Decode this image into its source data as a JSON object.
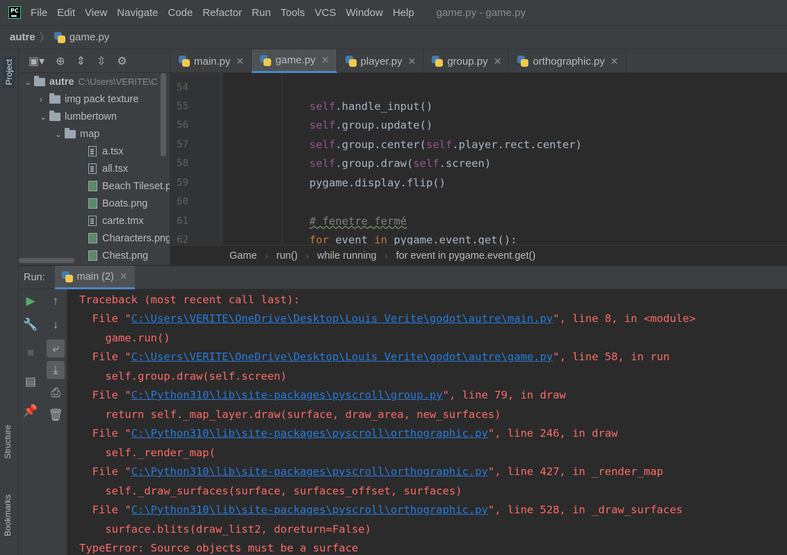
{
  "window": {
    "title": "game.py - game.py",
    "logo": "PC"
  },
  "menu": [
    "File",
    "Edit",
    "View",
    "Navigate",
    "Code",
    "Refactor",
    "Run",
    "Tools",
    "VCS",
    "Window",
    "Help"
  ],
  "nav": {
    "project": "autre",
    "separator": "〉",
    "file": "game.py"
  },
  "sidebar": {
    "project_tab": "Project",
    "structure_tab": "Structure",
    "bookmarks_tab": "Bookmarks"
  },
  "tree": {
    "root": {
      "name": "autre",
      "path": "C:\\Users\\VERITE\\C"
    },
    "items": [
      {
        "name": "img pack texture"
      },
      {
        "name": "lumbertown"
      },
      {
        "name": "map"
      },
      {
        "name": "a.tsx"
      },
      {
        "name": "all.tsx"
      },
      {
        "name": "Beach Tileset.p"
      },
      {
        "name": "Boats.png"
      },
      {
        "name": "carte.tmx"
      },
      {
        "name": "Characters.png"
      },
      {
        "name": "Chest.png"
      }
    ]
  },
  "tabs": [
    {
      "label": "main.py"
    },
    {
      "label": "game.py"
    },
    {
      "label": "player.py"
    },
    {
      "label": "group.py"
    },
    {
      "label": "orthographic.py"
    }
  ],
  "editor": {
    "line_numbers": [
      "54",
      "55",
      "56",
      "57",
      "58",
      "59",
      "60",
      "61",
      "62"
    ],
    "lines": [
      {
        "self": "",
        "rest": ""
      },
      {
        "self": "self",
        "rest": ".handle_input()"
      },
      {
        "self": "self",
        "rest": ".group.update()"
      },
      {
        "self": "self",
        "rest": ".group.center(",
        "self2": "self",
        "rest2": ".player.rect.center)"
      },
      {
        "self": "self",
        "rest": ".group.draw(",
        "self2": "self",
        "rest2": ".screen)"
      },
      {
        "self": "",
        "rest": "pygame.display.flip()"
      },
      {
        "self": "",
        "rest": ""
      },
      {
        "comment": "# fenetre fermé"
      },
      {
        "kw": "for",
        "mid": " event ",
        "kw2": "in",
        "rest": " pygame.event.get():"
      }
    ]
  },
  "crumbs": [
    "Game",
    "run()",
    "while running",
    "for event in pygame.event.get()"
  ],
  "run": {
    "label": "Run:",
    "tab": "main (2)"
  },
  "console": {
    "header": "Traceback (most recent call last):",
    "frames": [
      {
        "pre": "  File \"",
        "path": "C:\\Users\\VERITE\\OneDrive\\Desktop\\Louis Verite\\godot\\autre\\main.py",
        "post": "\", line 8, in <module>",
        "code": "    game.run()"
      },
      {
        "pre": "  File \"",
        "path": "C:\\Users\\VERITE\\OneDrive\\Desktop\\Louis Verite\\godot\\autre\\game.py",
        "post": "\", line 58, in run",
        "code": "    self.group.draw(self.screen)"
      },
      {
        "pre": "  File \"",
        "path": "C:\\Python310\\lib\\site-packages\\pyscroll\\group.py",
        "post": "\", line 79, in draw",
        "code": "    return self._map_layer.draw(surface, draw_area, new_surfaces)"
      },
      {
        "pre": "  File \"",
        "path": "C:\\Python310\\lib\\site-packages\\pyscroll\\orthographic.py",
        "post": "\", line 246, in draw",
        "code": "    self._render_map("
      },
      {
        "pre": "  File \"",
        "path": "C:\\Python310\\lib\\site-packages\\pyscroll\\orthographic.py",
        "post": "\", line 427, in _render_map",
        "code": "    self._draw_surfaces(surface, surfaces_offset, surfaces)"
      },
      {
        "pre": "  File \"",
        "path": "C:\\Python310\\lib\\site-packages\\pyscroll\\orthographic.py",
        "post": "\", line 528, in _draw_surfaces",
        "code": "    surface.blits(draw_list2, doreturn=False)"
      }
    ],
    "error": "TypeError: Source objects must be a surface"
  }
}
